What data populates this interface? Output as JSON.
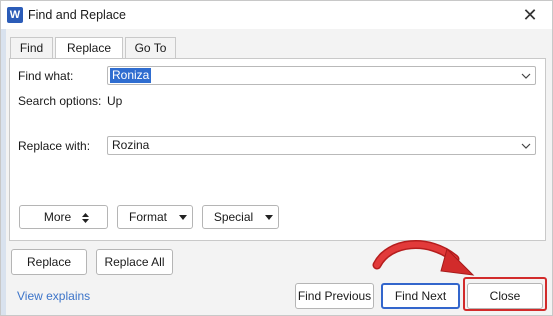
{
  "window": {
    "title": "Find and Replace",
    "app_icon_letter": "W",
    "close_glyph": "✕"
  },
  "tabs": [
    {
      "label": "Find",
      "active": false
    },
    {
      "label": "Replace",
      "active": true
    },
    {
      "label": "Go To",
      "active": false
    }
  ],
  "find": {
    "label": "Find what:",
    "value": "Roniza"
  },
  "search_options": {
    "label": "Search options:",
    "value": "Up"
  },
  "replace": {
    "label": "Replace with:",
    "value": "Rozina"
  },
  "option_buttons": {
    "more": "More",
    "format": "Format",
    "special": "Special",
    "more_glyph": "▼▲",
    "dropdown_glyph": "▼"
  },
  "actions": {
    "replace": "Replace",
    "replace_all": "Replace All",
    "find_previous": "Find Previous",
    "find_next": "Find Next",
    "close": "Close"
  },
  "link": {
    "view_explains": "View explains"
  },
  "colors": {
    "accent": "#2f6dd0",
    "highlight": "#d22b2b",
    "link": "#3c74c9"
  }
}
